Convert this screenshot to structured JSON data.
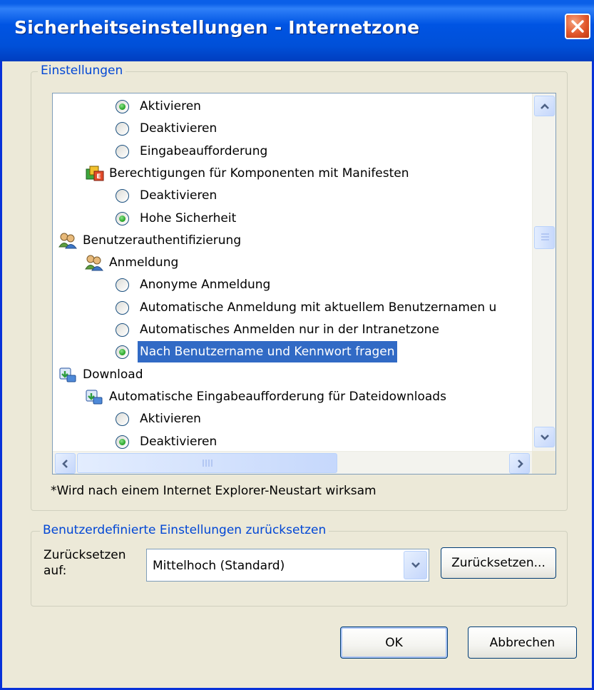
{
  "window": {
    "title": "Sicherheitseinstellungen - Internetzone"
  },
  "settings_group": {
    "legend": "Einstellungen",
    "rows": [
      {
        "kind": "radio",
        "checked": true,
        "label": "Aktivieren"
      },
      {
        "kind": "radio",
        "checked": false,
        "label": "Deaktivieren"
      },
      {
        "kind": "radio",
        "checked": false,
        "label": "Eingabeaufforderung"
      },
      {
        "kind": "category",
        "icon": "component-icon",
        "label": "Berechtigungen für Komponenten mit Manifesten"
      },
      {
        "kind": "radio",
        "checked": false,
        "label": "Deaktivieren"
      },
      {
        "kind": "radio",
        "checked": true,
        "label": "Hohe Sicherheit"
      },
      {
        "kind": "category",
        "icon": "users-icon",
        "label": "Benutzerauthentifizierung"
      },
      {
        "kind": "category",
        "icon": "users-icon",
        "label": "Anmeldung"
      },
      {
        "kind": "radio",
        "checked": false,
        "label": "Anonyme Anmeldung"
      },
      {
        "kind": "radio",
        "checked": false,
        "label": "Automatische Anmeldung mit aktuellem Benutzernamen u"
      },
      {
        "kind": "radio",
        "checked": false,
        "label": "Automatisches Anmelden nur in der Intranetzone"
      },
      {
        "kind": "radio",
        "checked": true,
        "label": "Nach Benutzername und Kennwort fragen",
        "selected": true
      },
      {
        "kind": "category",
        "icon": "download-icon",
        "label": "Download"
      },
      {
        "kind": "category",
        "icon": "download-icon",
        "label": "Automatische Eingabeaufforderung für Dateidownloads"
      },
      {
        "kind": "radio",
        "checked": false,
        "label": "Aktivieren"
      },
      {
        "kind": "radio",
        "checked": true,
        "label": "Deaktivieren"
      }
    ],
    "note": "*Wird nach einem Internet Explorer-Neustart wirksam"
  },
  "reset_group": {
    "legend": "Benutzerdefinierte Einstellungen zurücksetzen",
    "label_line1": "Zurücksetzen",
    "label_line2": "auf:",
    "selected_value": "Mittelhoch (Standard)",
    "reset_button": "Zurücksetzen..."
  },
  "buttons": {
    "ok": "OK",
    "cancel": "Abbrechen"
  },
  "colors": {
    "title_bar": "#0054E3",
    "selection": "#316AC5",
    "group_legend": "#0046D5",
    "radio_dot": "#21A121",
    "close_button": "#E2582C"
  }
}
